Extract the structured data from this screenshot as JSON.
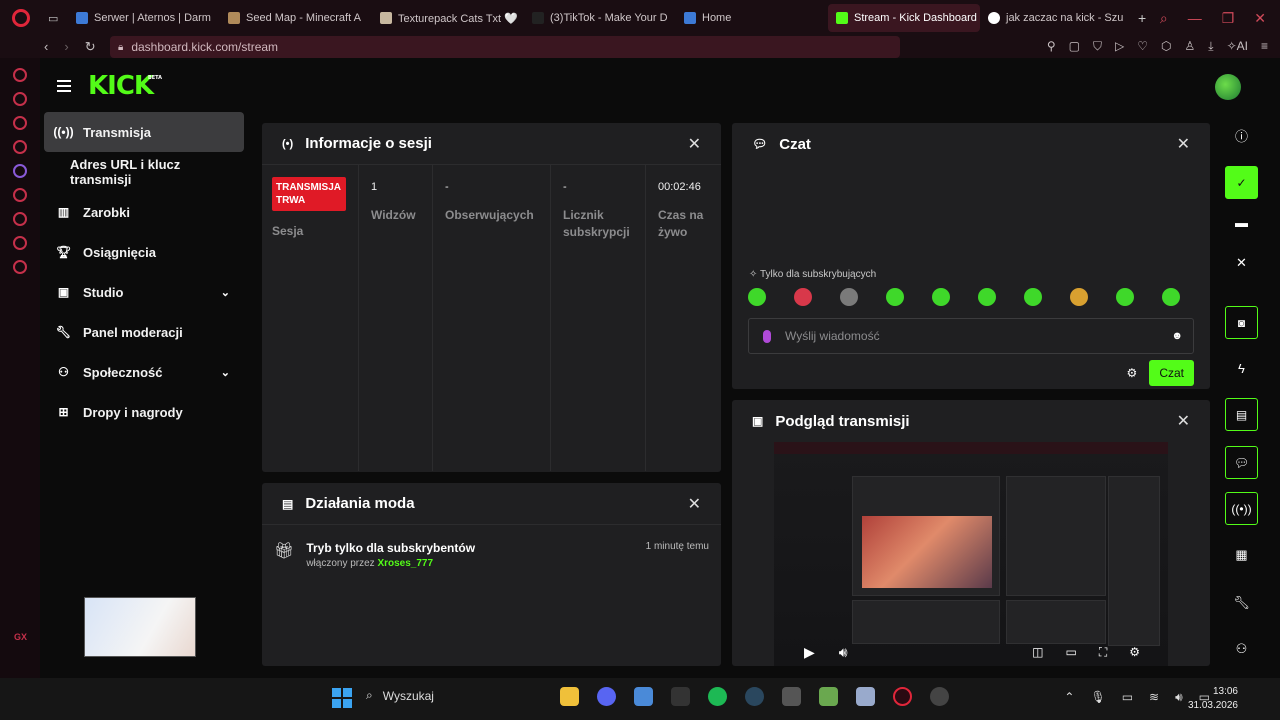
{
  "browser": {
    "tabs": [
      {
        "label": "Serwer | Aternos | Darm",
        "color": "#3d7ad6"
      },
      {
        "label": "Seed Map - Minecraft A",
        "color": "#b08a5a"
      },
      {
        "label": "Texturepack Cats Txt 🤍",
        "color": "#c8b8a0"
      },
      {
        "label": "(3)TikTok - Make Your D",
        "color": "#222222"
      },
      {
        "label": "Home",
        "color": "#3d7ad6"
      },
      {
        "label": "Stream - Kick Dashboard",
        "color": "#53fc18"
      },
      {
        "label": "jak zaczac na kick - Szu",
        "color": "#ffffff"
      }
    ],
    "url": "dashboard.kick.com/stream"
  },
  "kick": {
    "logo": "KICK",
    "logo_badge": "BETA"
  },
  "sidebar": {
    "items": [
      {
        "label": "Transmisja",
        "icon": "broadcast-icon"
      },
      {
        "label": "Adres URL i klucz transmisji",
        "icon": ""
      },
      {
        "label": "Zarobki",
        "icon": "chart-icon"
      },
      {
        "label": "Osiągnięcia",
        "icon": "trophy-icon"
      },
      {
        "label": "Studio",
        "icon": "studio-icon"
      },
      {
        "label": "Panel moderacji",
        "icon": "wrench-icon"
      },
      {
        "label": "Społeczność",
        "icon": "community-icon"
      },
      {
        "label": "Dropy i nagrody",
        "icon": "drops-icon"
      }
    ]
  },
  "session": {
    "title": "Informacje o sesji",
    "live_badge": "TRANSMISJA TRWA",
    "session_label": "Sesja",
    "stats": [
      {
        "value": "1",
        "label": "Widzów"
      },
      {
        "value": "-",
        "label": "Obserwujących"
      },
      {
        "value": "-",
        "label": "Licznik subskrypcji"
      },
      {
        "value": "00:02:46",
        "label": "Czas na żywo"
      }
    ]
  },
  "mod_actions": {
    "title": "Działania moda",
    "entry_title": "Tryb tylko dla subskrybentów",
    "entry_prefix": "włączony przez",
    "entry_user": "Xroses_777",
    "entry_time": "1 minutę temu"
  },
  "chat": {
    "title": "Czat",
    "sub_only": "Tylko dla subskrybujących",
    "placeholder": "Wyślij wiadomość",
    "send_label": "Czat"
  },
  "preview": {
    "title": "Podgląd transmisji"
  },
  "taskbar": {
    "search_label": "Wyszukaj",
    "time": "13:06",
    "date": "31.03.2026"
  },
  "colors": {
    "kick_green": "#53fc18",
    "live_red": "#e01a26",
    "panel_bg": "#1f1f21"
  }
}
